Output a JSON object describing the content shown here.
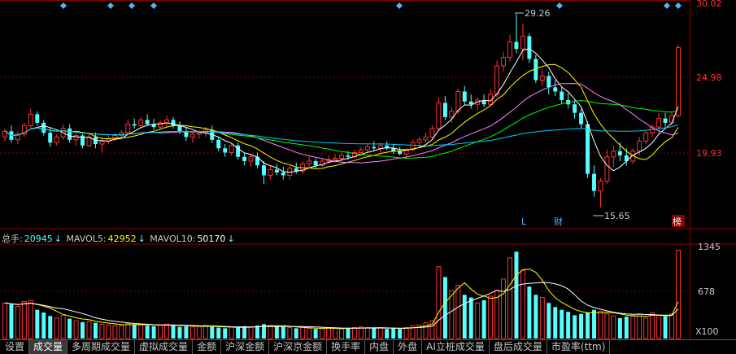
{
  "price_panel": {
    "axis_labels": [
      "30.02",
      "24.98",
      "19.93"
    ],
    "annotations": {
      "high": "29.26",
      "low": "15.65",
      "marker_l": "L",
      "marker_cai": "财",
      "marker_bang": "榜"
    }
  },
  "volume_panel": {
    "legend": {
      "main_label": "总手:",
      "main_value": "20945",
      "mavol5_label": "MAVOL5:",
      "mavol5_value": "42952",
      "mavol10_label": "MAVOL10:",
      "mavol10_value": "50170",
      "arrow": "↓",
      "arrow_up": "↓"
    },
    "axis_labels": [
      "1345",
      "678",
      "X100"
    ]
  },
  "tabs": [
    {
      "label": "设置",
      "active": false
    },
    {
      "label": "成交量",
      "active": true
    },
    {
      "label": "多周期成交量",
      "active": false
    },
    {
      "label": "虚拟成交量",
      "active": false
    },
    {
      "label": "金额",
      "active": false
    },
    {
      "label": "沪深金额",
      "active": false
    },
    {
      "label": "沪深京金额",
      "active": false
    },
    {
      "label": "换手率",
      "active": false
    },
    {
      "label": "内盘",
      "active": false
    },
    {
      "label": "外盘",
      "active": false
    },
    {
      "label": "AI立桩成交量",
      "active": false
    },
    {
      "label": "盘后成交量",
      "active": false
    },
    {
      "label": "市盈率(ttm)",
      "active": false
    }
  ],
  "colors": {
    "up": "#ff3232",
    "down": "#54ffff",
    "ma5": "#ffffff",
    "ma10": "#ffff00",
    "ma20": "#ff80ff",
    "ma30": "#00ff00",
    "ma60": "#00c8ff",
    "grid": "#8b0000"
  },
  "chart_data": {
    "type": "candlestick",
    "price_axis": [
      15.0,
      30.02
    ],
    "volume_axis": [
      0,
      1345
    ],
    "volume_unit": "X100",
    "candles": [
      [
        20.6,
        21.2,
        20.3,
        21.0
      ],
      [
        21.0,
        21.4,
        20.2,
        20.4
      ],
      [
        20.4,
        21.0,
        20.1,
        20.8
      ],
      [
        20.8,
        21.6,
        20.6,
        21.4
      ],
      [
        21.4,
        22.6,
        21.2,
        22.2
      ],
      [
        22.2,
        22.4,
        21.4,
        21.6
      ],
      [
        21.6,
        21.8,
        20.7,
        20.9
      ],
      [
        20.9,
        21.3,
        19.9,
        20.2
      ],
      [
        20.2,
        20.8,
        20.0,
        20.6
      ],
      [
        20.6,
        21.5,
        20.4,
        21.2
      ],
      [
        21.2,
        21.5,
        20.2,
        20.4
      ],
      [
        20.4,
        20.9,
        20.0,
        20.7
      ],
      [
        20.7,
        20.8,
        19.8,
        20.0
      ],
      [
        20.0,
        20.9,
        19.9,
        20.6
      ],
      [
        20.6,
        20.9,
        19.8,
        20.1
      ],
      [
        20.1,
        20.6,
        19.5,
        20.3
      ],
      [
        20.3,
        20.8,
        20.1,
        20.5
      ],
      [
        20.5,
        20.9,
        20.3,
        20.7
      ],
      [
        20.7,
        21.1,
        20.5,
        20.9
      ],
      [
        20.9,
        21.8,
        20.8,
        21.5
      ],
      [
        21.5,
        21.9,
        21.2,
        21.4
      ],
      [
        21.4,
        22.0,
        21.2,
        21.8
      ],
      [
        21.8,
        22.2,
        21.4,
        21.5
      ],
      [
        21.5,
        21.9,
        21.1,
        21.3
      ],
      [
        21.3,
        21.8,
        21.2,
        21.6
      ],
      [
        21.6,
        22.1,
        21.3,
        21.8
      ],
      [
        21.8,
        22.0,
        21.2,
        21.4
      ],
      [
        21.4,
        21.7,
        20.8,
        21.0
      ],
      [
        21.0,
        21.3,
        20.3,
        20.6
      ],
      [
        20.6,
        21.0,
        20.2,
        20.8
      ],
      [
        20.8,
        21.1,
        20.5,
        20.9
      ],
      [
        20.9,
        21.3,
        20.6,
        21.1
      ],
      [
        21.1,
        21.4,
        20.2,
        20.4
      ],
      [
        20.4,
        20.6,
        19.6,
        19.8
      ],
      [
        19.8,
        20.1,
        19.2,
        19.5
      ],
      [
        19.5,
        20.2,
        19.3,
        20.0
      ],
      [
        20.0,
        20.2,
        19.0,
        19.2
      ],
      [
        19.2,
        19.5,
        18.6,
        18.9
      ],
      [
        18.9,
        19.4,
        18.5,
        19.2
      ],
      [
        19.2,
        19.5,
        18.4,
        18.6
      ],
      [
        18.6,
        18.9,
        17.3,
        17.9
      ],
      [
        17.9,
        18.6,
        17.6,
        18.3
      ],
      [
        18.3,
        18.7,
        17.9,
        18.1
      ],
      [
        18.1,
        18.5,
        17.6,
        17.9
      ],
      [
        17.9,
        18.6,
        17.6,
        18.4
      ],
      [
        18.4,
        18.8,
        18.0,
        18.2
      ],
      [
        18.2,
        18.9,
        18.0,
        18.7
      ],
      [
        18.7,
        19.2,
        18.5,
        18.9
      ],
      [
        18.9,
        19.1,
        18.4,
        18.6
      ],
      [
        18.6,
        19.1,
        18.5,
        18.9
      ],
      [
        18.9,
        19.3,
        18.7,
        19.0
      ],
      [
        19.0,
        19.4,
        18.8,
        19.1
      ],
      [
        19.1,
        19.5,
        18.9,
        19.3
      ],
      [
        19.3,
        19.6,
        19.0,
        19.2
      ],
      [
        19.2,
        19.7,
        19.1,
        19.5
      ],
      [
        19.5,
        19.9,
        19.3,
        19.7
      ],
      [
        19.7,
        20.1,
        19.5,
        19.9
      ],
      [
        19.9,
        20.3,
        19.6,
        19.8
      ],
      [
        19.8,
        20.2,
        19.5,
        20.0
      ],
      [
        20.0,
        20.3,
        19.7,
        19.8
      ],
      [
        19.8,
        20.1,
        19.4,
        19.6
      ],
      [
        19.6,
        19.9,
        19.3,
        19.4
      ],
      [
        19.4,
        19.8,
        19.2,
        19.7
      ],
      [
        19.7,
        20.4,
        19.6,
        20.2
      ],
      [
        20.2,
        20.6,
        19.9,
        20.4
      ],
      [
        20.4,
        20.9,
        20.2,
        20.6
      ],
      [
        20.6,
        21.4,
        20.5,
        21.2
      ],
      [
        21.2,
        23.4,
        21.1,
        23.0
      ],
      [
        23.0,
        23.5,
        21.8,
        22.0
      ],
      [
        22.0,
        22.7,
        21.6,
        22.4
      ],
      [
        22.4,
        24.0,
        22.2,
        23.8
      ],
      [
        23.8,
        24.2,
        22.9,
        23.1
      ],
      [
        23.1,
        23.6,
        22.6,
        22.9
      ],
      [
        22.9,
        23.4,
        22.5,
        23.2
      ],
      [
        23.2,
        23.6,
        22.7,
        22.9
      ],
      [
        22.9,
        24.0,
        22.8,
        23.6
      ],
      [
        23.6,
        26.0,
        23.4,
        25.6
      ],
      [
        25.6,
        26.6,
        25.2,
        26.2
      ],
      [
        26.2,
        27.8,
        25.9,
        27.3
      ],
      [
        27.3,
        29.26,
        26.5,
        26.8
      ],
      [
        26.8,
        28.6,
        26.0,
        27.7
      ],
      [
        27.7,
        27.9,
        25.8,
        26.1
      ],
      [
        26.1,
        26.4,
        24.4,
        24.6
      ],
      [
        24.6,
        25.4,
        24.2,
        24.9
      ],
      [
        24.9,
        25.2,
        23.6,
        24.1
      ],
      [
        24.1,
        24.6,
        23.5,
        23.8
      ],
      [
        23.8,
        24.1,
        22.9,
        23.2
      ],
      [
        23.2,
        23.7,
        22.6,
        22.9
      ],
      [
        22.9,
        23.2,
        21.9,
        22.3
      ],
      [
        22.3,
        22.6,
        21.2,
        21.5
      ],
      [
        21.5,
        21.7,
        17.7,
        18.0
      ],
      [
        18.0,
        18.6,
        16.4,
        16.8
      ],
      [
        16.8,
        17.7,
        15.65,
        17.5
      ],
      [
        17.5,
        19.7,
        17.3,
        19.2
      ],
      [
        19.2,
        20.0,
        18.5,
        19.6
      ],
      [
        19.6,
        20.2,
        18.9,
        19.3
      ],
      [
        19.3,
        19.8,
        18.6,
        18.9
      ],
      [
        18.9,
        19.8,
        18.7,
        19.6
      ],
      [
        19.6,
        20.6,
        19.3,
        20.3
      ],
      [
        20.3,
        21.1,
        20.1,
        20.9
      ],
      [
        20.9,
        21.5,
        20.6,
        21.3
      ],
      [
        21.3,
        22.3,
        20.8,
        21.9
      ],
      [
        21.9,
        22.3,
        21.3,
        21.6
      ],
      [
        21.6,
        22.4,
        21.4,
        22.1
      ],
      [
        22.1,
        27.1,
        22.0,
        26.9
      ]
    ],
    "volume": [
      520,
      500,
      470,
      540,
      560,
      420,
      380,
      330,
      300,
      340,
      290,
      260,
      240,
      250,
      230,
      210,
      200,
      190,
      190,
      220,
      210,
      200,
      190,
      180,
      200,
      210,
      190,
      170,
      180,
      170,
      180,
      190,
      170,
      160,
      150,
      170,
      160,
      180,
      170,
      190,
      210,
      190,
      180,
      170,
      160,
      150,
      160,
      150,
      140,
      150,
      160,
      150,
      140,
      150,
      160,
      170,
      160,
      150,
      160,
      140,
      150,
      140,
      160,
      190,
      200,
      230,
      260,
      1050,
      900,
      700,
      780,
      640,
      600,
      520,
      560,
      620,
      700,
      870,
      1180,
      1270,
      1000,
      760,
      640,
      600,
      520,
      460,
      420,
      390,
      340,
      360,
      380,
      420,
      400,
      360,
      330,
      300,
      320,
      340,
      360,
      300,
      380,
      340,
      330,
      360,
      1290
    ]
  }
}
